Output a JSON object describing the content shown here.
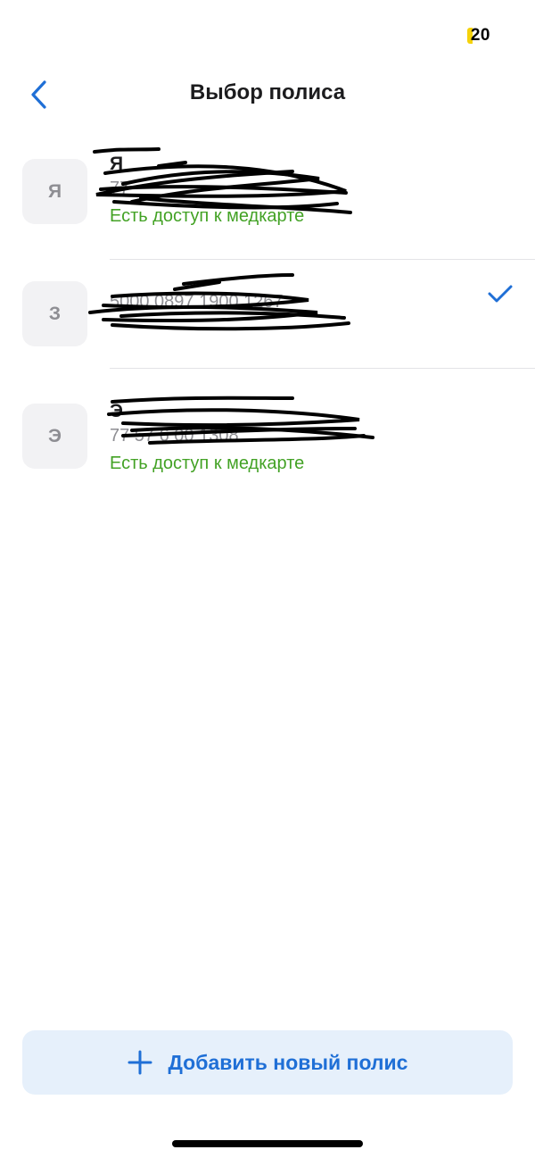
{
  "status_bar": {
    "battery_level": "20"
  },
  "header": {
    "title": "Выбор полиса"
  },
  "policies": [
    {
      "initial": "Я",
      "name": "Я",
      "number": "77",
      "access": "Есть доступ к медкарте",
      "selected": false
    },
    {
      "initial": "З",
      "name": "",
      "number": "5000 0897 1900 1267",
      "access": "",
      "selected": true
    },
    {
      "initial": "Э",
      "name": "Э",
      "number": "77 57 6 00 1308",
      "access": "Есть доступ к медкарте",
      "selected": false
    }
  ],
  "footer": {
    "add_button_label": "Добавить новый полис"
  },
  "colors": {
    "accent": "#1f6fd6",
    "access_green": "#43a225",
    "avatar_bg": "#f2f2f4",
    "add_button_bg": "#e6f0fb"
  }
}
